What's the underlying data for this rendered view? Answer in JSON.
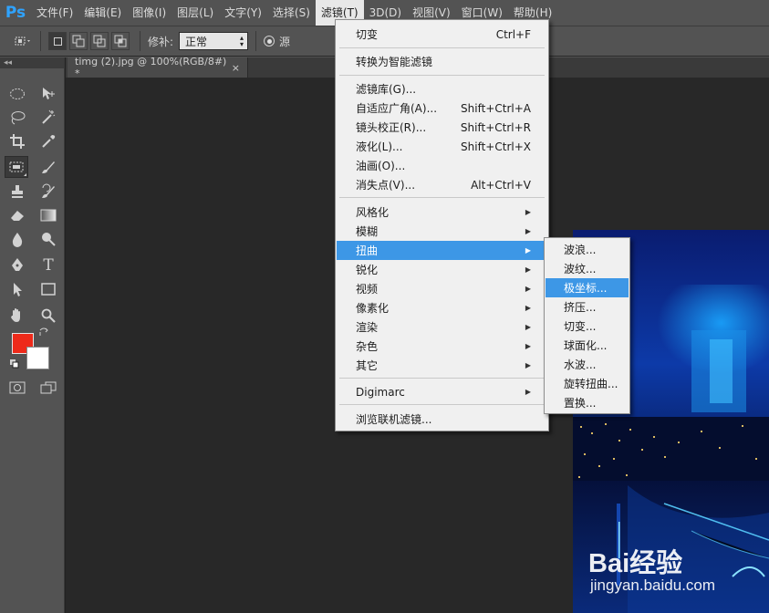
{
  "app": {
    "logo": "Ps"
  },
  "menubar": [
    "文件(F)",
    "编辑(E)",
    "图像(I)",
    "图层(L)",
    "文字(Y)",
    "选择(S)",
    "滤镜(T)",
    "3D(D)",
    "视图(V)",
    "窗口(W)",
    "帮助(H)"
  ],
  "options": {
    "repair_label": "修补:",
    "repair_value": "正常",
    "source_label": "源"
  },
  "toolbox": {
    "collapse": "◂◂"
  },
  "document": {
    "tab_title": "timg (2).jpg @ 100%(RGB/8#) *",
    "close": "×"
  },
  "filter_menu": {
    "last_filter": {
      "label": "切变",
      "shortcut": "Ctrl+F"
    },
    "convert_smart": "转换为智能滤镜",
    "gallery": "滤镜库(G)...",
    "adaptive_wide": {
      "label": "自适应广角(A)...",
      "shortcut": "Shift+Ctrl+A"
    },
    "lens_correction": {
      "label": "镜头校正(R)...",
      "shortcut": "Shift+Ctrl+R"
    },
    "liquify": {
      "label": "液化(L)...",
      "shortcut": "Shift+Ctrl+X"
    },
    "oil_paint": "油画(O)...",
    "vanishing_point": {
      "label": "消失点(V)...",
      "shortcut": "Alt+Ctrl+V"
    },
    "stylize": "风格化",
    "blur": "模糊",
    "distort": "扭曲",
    "sharpen": "锐化",
    "video": "视频",
    "pixelate": "像素化",
    "render": "渲染",
    "noise": "杂色",
    "other": "其它",
    "digimarc": "Digimarc",
    "browse_online": "浏览联机滤镜..."
  },
  "distort_submenu": [
    "波浪...",
    "波纹...",
    "极坐标...",
    "挤压...",
    "切变...",
    "球面化...",
    "水波...",
    "旋转扭曲...",
    "置换..."
  ],
  "watermark": {
    "brand": "Bai经验",
    "url": "jingyan.baidu.com"
  },
  "colors": {
    "foreground": "#ee2a1a",
    "background": "#ffffff",
    "highlight": "#3d97e6"
  }
}
